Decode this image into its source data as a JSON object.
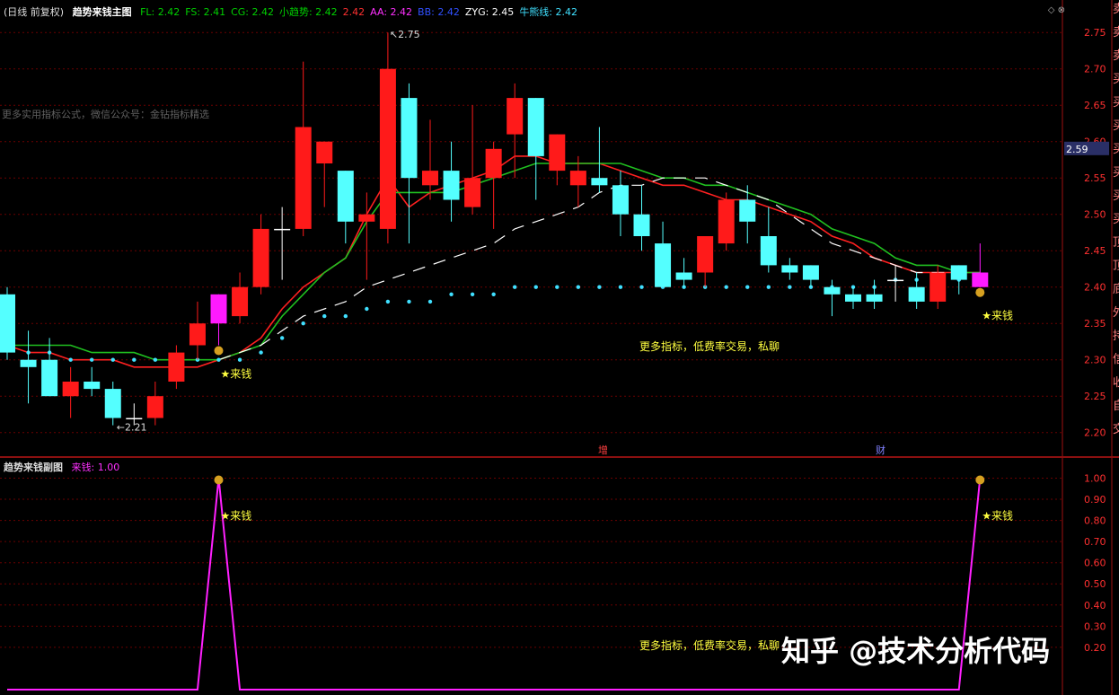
{
  "header": {
    "period": "(日线 前复权)",
    "indicator_name": "趋势来钱主图",
    "fields": [
      {
        "label": "FL: 2.42",
        "color": "#00d000"
      },
      {
        "label": "FS: 2.41",
        "color": "#00d000"
      },
      {
        "label": "CG: 2.42",
        "color": "#00d000"
      },
      {
        "label": "小趋势: 2.42",
        "color": "#00d000"
      },
      {
        "label": "2.42",
        "color": "#ff3030"
      },
      {
        "label": "AA: 2.42",
        "color": "#ff30ff"
      },
      {
        "label": "BB: 2.42",
        "color": "#3050ff"
      },
      {
        "label": "ZYG: 2.45",
        "color": "#ffffff"
      },
      {
        "label": "牛熊线: 2.42",
        "color": "#40e0ff"
      }
    ]
  },
  "sub_header": {
    "indicator_name": "趋势来钱副图",
    "field": "来钱: 1.00"
  },
  "main_texts": {
    "left_note": "更多实用指标公式，微信公众号：金钻指标精选",
    "promo": "更多指标，低费率交易，私聊",
    "marker_zeng": "增",
    "marker_cai": "财",
    "signal": "★来钱",
    "current_price": "2.59",
    "high_label": "2.75",
    "low_label": "2.21"
  },
  "sub_texts": {
    "promo": "更多指标，低费率交易，私聊",
    "signal": "★来钱"
  },
  "right_side_chars": [
    "卖",
    "卖",
    "卖",
    "买",
    "买",
    "买",
    "买",
    "买",
    "买",
    "买",
    "顶",
    "顶",
    "底",
    "外",
    "持",
    "信",
    "收",
    "自",
    "交"
  ],
  "watermark": "知乎 @技术分析代码",
  "colors": {
    "up": "#ff1a1a",
    "down": "#54ffff",
    "magenta": "#ff1aff",
    "grid": "#6a0000",
    "axis_text": "#ff3030"
  },
  "chart_data": [
    {
      "type": "candlestick",
      "title": "趋势来钱主图",
      "ylim": [
        2.17,
        2.77
      ],
      "yticks": [
        2.2,
        2.25,
        2.3,
        2.35,
        2.4,
        2.45,
        2.5,
        2.55,
        2.6,
        2.65,
        2.7,
        2.75
      ],
      "candles": [
        {
          "o": 2.39,
          "h": 2.4,
          "l": 2.3,
          "c": 2.31,
          "k": "down"
        },
        {
          "o": 2.3,
          "h": 2.34,
          "l": 2.24,
          "c": 2.29,
          "k": "down"
        },
        {
          "o": 2.3,
          "h": 2.33,
          "l": 2.25,
          "c": 2.25,
          "k": "down"
        },
        {
          "o": 2.25,
          "h": 2.29,
          "l": 2.22,
          "c": 2.27,
          "k": "up"
        },
        {
          "o": 2.27,
          "h": 2.29,
          "l": 2.25,
          "c": 2.26,
          "k": "down"
        },
        {
          "o": 2.26,
          "h": 2.27,
          "l": 2.21,
          "c": 2.22,
          "k": "down"
        },
        {
          "o": 2.22,
          "h": 2.24,
          "l": 2.21,
          "c": 2.22,
          "k": "cross"
        },
        {
          "o": 2.22,
          "h": 2.27,
          "l": 2.21,
          "c": 2.25,
          "k": "up"
        },
        {
          "o": 2.27,
          "h": 2.32,
          "l": 2.26,
          "c": 2.31,
          "k": "up"
        },
        {
          "o": 2.32,
          "h": 2.38,
          "l": 2.3,
          "c": 2.35,
          "k": "up"
        },
        {
          "o": 2.35,
          "h": 2.39,
          "l": 2.32,
          "c": 2.39,
          "k": "magenta"
        },
        {
          "o": 2.36,
          "h": 2.42,
          "l": 2.35,
          "c": 2.4,
          "k": "up"
        },
        {
          "o": 2.4,
          "h": 2.5,
          "l": 2.39,
          "c": 2.48,
          "k": "up"
        },
        {
          "o": 2.48,
          "h": 2.51,
          "l": 2.41,
          "c": 2.48,
          "k": "cross"
        },
        {
          "o": 2.48,
          "h": 2.71,
          "l": 2.47,
          "c": 2.62,
          "k": "up"
        },
        {
          "o": 2.57,
          "h": 2.6,
          "l": 2.51,
          "c": 2.6,
          "k": "up"
        },
        {
          "o": 2.56,
          "h": 2.56,
          "l": 2.46,
          "c": 2.49,
          "k": "down"
        },
        {
          "o": 2.49,
          "h": 2.53,
          "l": 2.41,
          "c": 2.5,
          "k": "up"
        },
        {
          "o": 2.48,
          "h": 2.75,
          "l": 2.46,
          "c": 2.7,
          "k": "up"
        },
        {
          "o": 2.66,
          "h": 2.68,
          "l": 2.46,
          "c": 2.55,
          "k": "down"
        },
        {
          "o": 2.54,
          "h": 2.63,
          "l": 2.52,
          "c": 2.56,
          "k": "up"
        },
        {
          "o": 2.56,
          "h": 2.6,
          "l": 2.49,
          "c": 2.52,
          "k": "down"
        },
        {
          "o": 2.51,
          "h": 2.65,
          "l": 2.5,
          "c": 2.55,
          "k": "up"
        },
        {
          "o": 2.55,
          "h": 2.6,
          "l": 2.48,
          "c": 2.59,
          "k": "up"
        },
        {
          "o": 2.61,
          "h": 2.68,
          "l": 2.55,
          "c": 2.66,
          "k": "up"
        },
        {
          "o": 2.66,
          "h": 2.66,
          "l": 2.52,
          "c": 2.58,
          "k": "down"
        },
        {
          "o": 2.56,
          "h": 2.61,
          "l": 2.54,
          "c": 2.61,
          "k": "up"
        },
        {
          "o": 2.54,
          "h": 2.58,
          "l": 2.51,
          "c": 2.56,
          "k": "up"
        },
        {
          "o": 2.55,
          "h": 2.62,
          "l": 2.53,
          "c": 2.54,
          "k": "down"
        },
        {
          "o": 2.54,
          "h": 2.56,
          "l": 2.47,
          "c": 2.5,
          "k": "down"
        },
        {
          "o": 2.5,
          "h": 2.54,
          "l": 2.45,
          "c": 2.47,
          "k": "down"
        },
        {
          "o": 2.46,
          "h": 2.49,
          "l": 2.4,
          "c": 2.4,
          "k": "down"
        },
        {
          "o": 2.42,
          "h": 2.44,
          "l": 2.4,
          "c": 2.41,
          "k": "down"
        },
        {
          "o": 2.42,
          "h": 2.47,
          "l": 2.4,
          "c": 2.47,
          "k": "up"
        },
        {
          "o": 2.46,
          "h": 2.53,
          "l": 2.45,
          "c": 2.52,
          "k": "up"
        },
        {
          "o": 2.52,
          "h": 2.54,
          "l": 2.46,
          "c": 2.49,
          "k": "down"
        },
        {
          "o": 2.47,
          "h": 2.51,
          "l": 2.42,
          "c": 2.43,
          "k": "down"
        },
        {
          "o": 2.43,
          "h": 2.44,
          "l": 2.41,
          "c": 2.42,
          "k": "down"
        },
        {
          "o": 2.43,
          "h": 2.43,
          "l": 2.4,
          "c": 2.41,
          "k": "down"
        },
        {
          "o": 2.4,
          "h": 2.41,
          "l": 2.36,
          "c": 2.39,
          "k": "down"
        },
        {
          "o": 2.39,
          "h": 2.4,
          "l": 2.37,
          "c": 2.38,
          "k": "down"
        },
        {
          "o": 2.39,
          "h": 2.41,
          "l": 2.37,
          "c": 2.38,
          "k": "down"
        },
        {
          "o": 2.41,
          "h": 2.43,
          "l": 2.38,
          "c": 2.41,
          "k": "cross"
        },
        {
          "o": 2.4,
          "h": 2.42,
          "l": 2.37,
          "c": 2.38,
          "k": "down"
        },
        {
          "o": 2.38,
          "h": 2.43,
          "l": 2.37,
          "c": 2.42,
          "k": "up"
        },
        {
          "o": 2.43,
          "h": 2.43,
          "l": 2.39,
          "c": 2.41,
          "k": "down"
        },
        {
          "o": 2.42,
          "h": 2.46,
          "l": 2.4,
          "c": 2.4,
          "k": "magenta"
        }
      ],
      "series": [
        {
          "color": "#ff2020",
          "values": [
            2.32,
            2.31,
            2.31,
            2.3,
            2.3,
            2.3,
            2.29,
            2.29,
            2.29,
            2.29,
            2.3,
            2.31,
            2.33,
            2.37,
            2.4,
            2.42,
            2.44,
            2.5,
            2.55,
            2.51,
            2.53,
            2.54,
            2.55,
            2.56,
            2.58,
            2.58,
            2.57,
            2.57,
            2.57,
            2.56,
            2.55,
            2.54,
            2.54,
            2.53,
            2.52,
            2.52,
            2.51,
            2.5,
            2.49,
            2.47,
            2.46,
            2.44,
            2.43,
            2.42,
            2.42,
            2.42,
            2.42
          ]
        },
        {
          "color": "#20c020",
          "values": [
            2.32,
            2.32,
            2.32,
            2.32,
            2.31,
            2.31,
            2.31,
            2.3,
            2.3,
            2.3,
            2.3,
            2.31,
            2.32,
            2.36,
            2.39,
            2.42,
            2.44,
            2.49,
            2.53,
            2.53,
            2.53,
            2.53,
            2.54,
            2.55,
            2.56,
            2.57,
            2.57,
            2.57,
            2.57,
            2.57,
            2.56,
            2.55,
            2.55,
            2.54,
            2.54,
            2.53,
            2.52,
            2.51,
            2.5,
            2.48,
            2.47,
            2.46,
            2.44,
            2.43,
            2.43,
            2.42,
            2.42
          ]
        },
        {
          "color": "#ffffff",
          "dashed": true,
          "values": [
            null,
            null,
            null,
            null,
            null,
            null,
            null,
            null,
            null,
            null,
            2.3,
            2.31,
            2.32,
            2.34,
            2.36,
            2.37,
            2.38,
            2.4,
            2.41,
            2.42,
            2.43,
            2.44,
            2.45,
            2.46,
            2.48,
            2.49,
            2.5,
            2.51,
            2.53,
            2.54,
            2.54,
            2.55,
            2.55,
            2.55,
            2.54,
            2.53,
            2.52,
            2.5,
            2.48,
            2.46,
            2.45,
            2.44,
            2.43,
            2.42,
            2.42,
            2.42,
            null
          ]
        }
      ],
      "dots": {
        "color": "#40e0ff",
        "values": [
          2.32,
          2.31,
          2.31,
          2.3,
          2.3,
          2.3,
          2.3,
          2.3,
          2.3,
          2.3,
          2.3,
          2.3,
          2.31,
          2.33,
          2.35,
          2.36,
          2.36,
          2.37,
          2.38,
          2.38,
          2.38,
          2.39,
          2.39,
          2.39,
          2.4,
          2.4,
          2.4,
          2.4,
          2.4,
          2.4,
          2.4,
          2.4,
          2.4,
          2.4,
          2.4,
          2.4,
          2.4,
          2.4,
          2.4,
          2.4,
          2.4,
          2.4,
          2.41,
          2.41,
          2.41,
          2.41,
          null
        ]
      },
      "signals": [
        10,
        46
      ]
    },
    {
      "type": "line",
      "title": "趋势来钱副图",
      "ylim": [
        0,
        1.07
      ],
      "yticks": [
        0.2,
        0.3,
        0.4,
        0.5,
        0.6,
        0.7,
        0.8,
        0.9,
        1.0
      ],
      "series": [
        {
          "name": "来钱",
          "color": "#ff20ff",
          "values": [
            0,
            0,
            0,
            0,
            0,
            0,
            0,
            0,
            0,
            0,
            1,
            0,
            0,
            0,
            0,
            0,
            0,
            0,
            0,
            0,
            0,
            0,
            0,
            0,
            0,
            0,
            0,
            0,
            0,
            0,
            0,
            0,
            0,
            0,
            0,
            0,
            0,
            0,
            0,
            0,
            0,
            0,
            0,
            0,
            0,
            0,
            1
          ]
        }
      ]
    }
  ]
}
